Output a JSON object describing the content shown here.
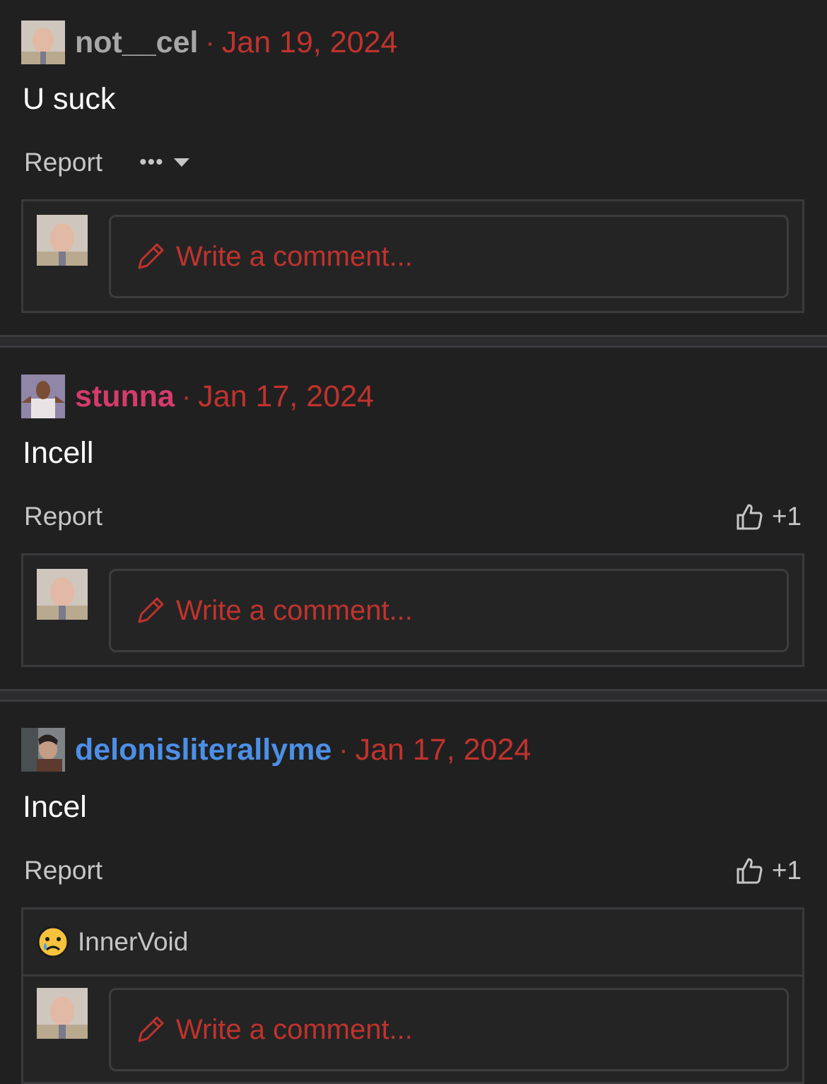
{
  "comments": [
    {
      "username": "not__cel",
      "username_color": "#a7a7a7",
      "date": "Jan 19, 2024",
      "text": "U suck",
      "report_label": "Report",
      "more_label": "•••",
      "placeholder": "Write a comment..."
    },
    {
      "username": "stunna",
      "username_color": "#d43c6a",
      "date": "Jan 17, 2024",
      "text": "Incell",
      "report_label": "Report",
      "like_count": "+1",
      "placeholder": "Write a comment..."
    },
    {
      "username": "delonisliterallyme",
      "username_color": "#4c8fe6",
      "date": "Jan 17, 2024",
      "text": "Incel",
      "report_label": "Report",
      "like_count": "+1",
      "reaction": {
        "emoji": "😢",
        "label": "InnerVoid"
      },
      "placeholder": "Write a comment..."
    }
  ],
  "separator": "·",
  "colors": {
    "background": "#202021",
    "accent_red": "#c0332c",
    "muted": "#c6c6c6"
  },
  "icons": [
    "pencil-icon",
    "thumbs-up-icon",
    "chevron-down-icon",
    "crying-face-icon"
  ]
}
